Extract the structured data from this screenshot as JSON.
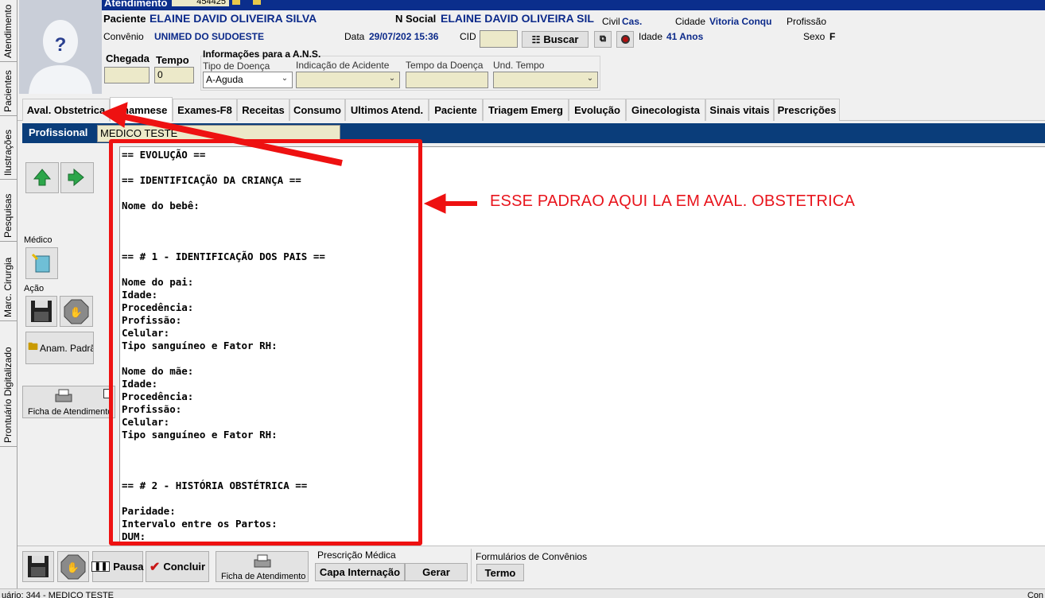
{
  "vertical_tabs": [
    "Atendimento",
    "Pacientes",
    "Ilustrações",
    "Pesquisas",
    "Marc. Cirurgia",
    "Prontuário Digitalizado"
  ],
  "header": {
    "atendimento_label": "Atendimento",
    "atendimento_value": "454425",
    "paciente_label": "Paciente",
    "paciente_value": "ELAINE DAVID OLIVEIRA SILVA",
    "nsocial_label": "N Social",
    "nsocial_value": "ELAINE DAVID OLIVEIRA SIL",
    "civil_label": "Civil",
    "civil_value": "Cas.",
    "cidade_label": "Cidade",
    "cidade_value": "Vitoria Conqu",
    "profissao_label": "Profissão",
    "convenio_label": "Convênio",
    "convenio_value": "UNIMED DO SUDOESTE",
    "data_label": "Data",
    "data_value": "29/07/202 15:36",
    "cid_label": "CID",
    "buscar_label": "Buscar",
    "idade_label": "Idade",
    "idade_value": "41 Anos",
    "sexo_label": "Sexo",
    "sexo_value": "F",
    "chegada_label": "Chegada",
    "tempo_label": "Tempo",
    "tempo_value": "0",
    "ans_title": "Informações para a A.N.S.",
    "tipo_doenca_label": "Tipo de Doença",
    "tipo_doenca_value": "A-Aguda",
    "indicacao_label": "Indicação de Acidente",
    "tempo_doenca_label": "Tempo da Doença",
    "und_tempo_label": "Und. Tempo"
  },
  "tabs": [
    "Aval. Obstetrica",
    "Anamnese",
    "Exames-F8",
    "Receitas",
    "Consumo",
    "Ultimos Atend.",
    "Paciente",
    "Triagem Emerg",
    "Evolução",
    "Ginecologista",
    "Sinais vitais",
    "Prescrições"
  ],
  "active_tab": "Anamnese",
  "profissional": {
    "label": "Profissional",
    "value": "MEDICO TESTE"
  },
  "sidebar": {
    "medico_label": "Médico",
    "acao_label": "Ação",
    "anam_padrao_label": "Anam. Padrã",
    "ficha_label": "Ficha de Atendimento"
  },
  "editor_lines": [
    "== EVOLUÇÃO ==",
    "",
    "== IDENTIFICAÇÃO DA CRIANÇA ==",
    "",
    "Nome do bebê:",
    "",
    "",
    "",
    "== # 1 - IDENTIFICAÇÃO DOS PAIS ==",
    "",
    "Nome do pai:",
    "Idade:",
    "Procedência:",
    "Profissão:",
    "Celular:",
    "Tipo sanguíneo e Fator RH:",
    "",
    "Nome do mãe:",
    "Idade:",
    "Procedência:",
    "Profissão:",
    "Celular:",
    "Tipo sanguíneo e Fator RH:",
    "",
    "",
    "",
    "== # 2 - HISTÓRIA OBSTÉTRICA ==",
    "",
    "Paridade:",
    "Intervalo entre os Partos:",
    "DUM:"
  ],
  "annotation": "ESSE PADRAO AQUI LA EM AVAL. OBSTETRICA",
  "bottom": {
    "pausa_label": "Pausa",
    "concluir_label": "Concluir",
    "ficha_label": "Ficha de Atendimento",
    "prescricao_title": "Prescrição Médica",
    "capa_label": "Capa Internação",
    "gerar_label": "Gerar",
    "formularios_title": "Formulários de Convênios",
    "termo_label": "Termo"
  },
  "status_text": "uário: 344 - MEDICO TESTE",
  "status_right": "Con",
  "colors": {
    "header_blue": "#0b2e8c",
    "prof_bar": "#0a3d7a",
    "field_bg": "#ece9c9",
    "annotation_red": "#e8141c"
  }
}
